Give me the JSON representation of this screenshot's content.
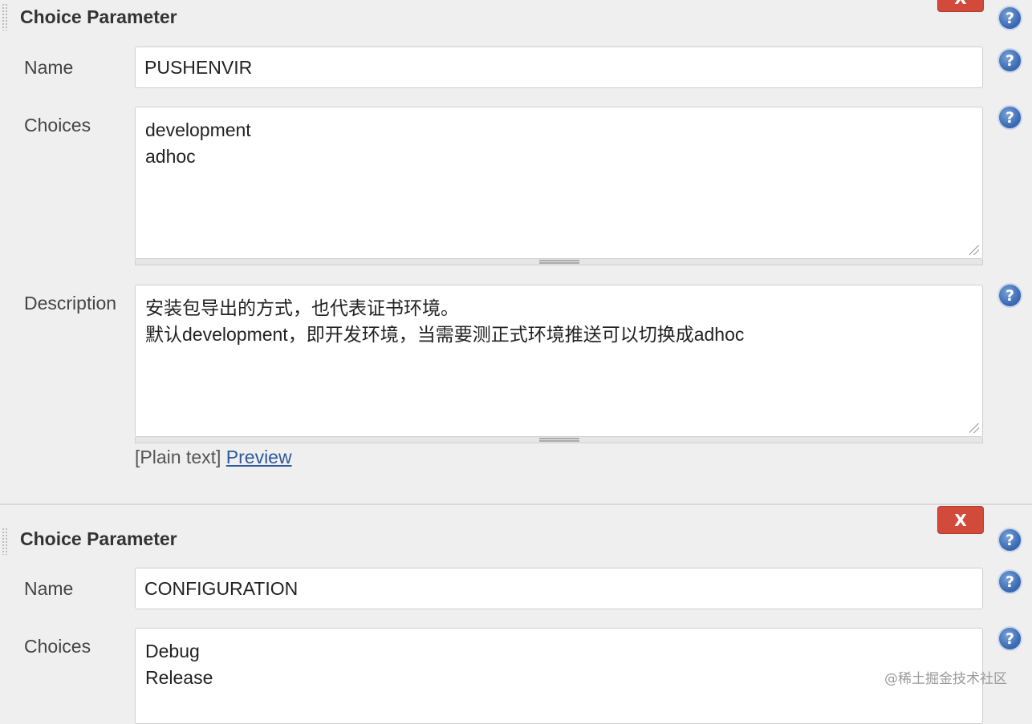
{
  "params": [
    {
      "title": "Choice Parameter",
      "delete_label": "X",
      "help_glyph": "?",
      "name_label": "Name",
      "name_value": "PUSHENVIR",
      "choices_label": "Choices",
      "choices": [
        "development",
        "adhoc"
      ],
      "description_label": "Description",
      "description": [
        "安装包导出的方式，也代表证书环境。",
        "默认development，即开发环境，当需要测正式环境推送可以切换成adhoc"
      ],
      "format_prefix": "[Plain text]",
      "preview_link": "Preview"
    },
    {
      "title": "Choice Parameter",
      "delete_label": "X",
      "help_glyph": "?",
      "name_label": "Name",
      "name_value": "CONFIGURATION",
      "choices_label": "Choices",
      "choices": [
        "Debug",
        "Release"
      ]
    }
  ],
  "watermark": "@稀土掘金技术社区",
  "colors": {
    "delete_button": "#d24a3a",
    "help_icon": "#3e6db5",
    "link": "#2d5a9a",
    "background": "#efefef"
  },
  "icons": {
    "help": "question-circle-icon",
    "grip": "drag-grip-icon",
    "resize": "resize-corner-icon"
  }
}
